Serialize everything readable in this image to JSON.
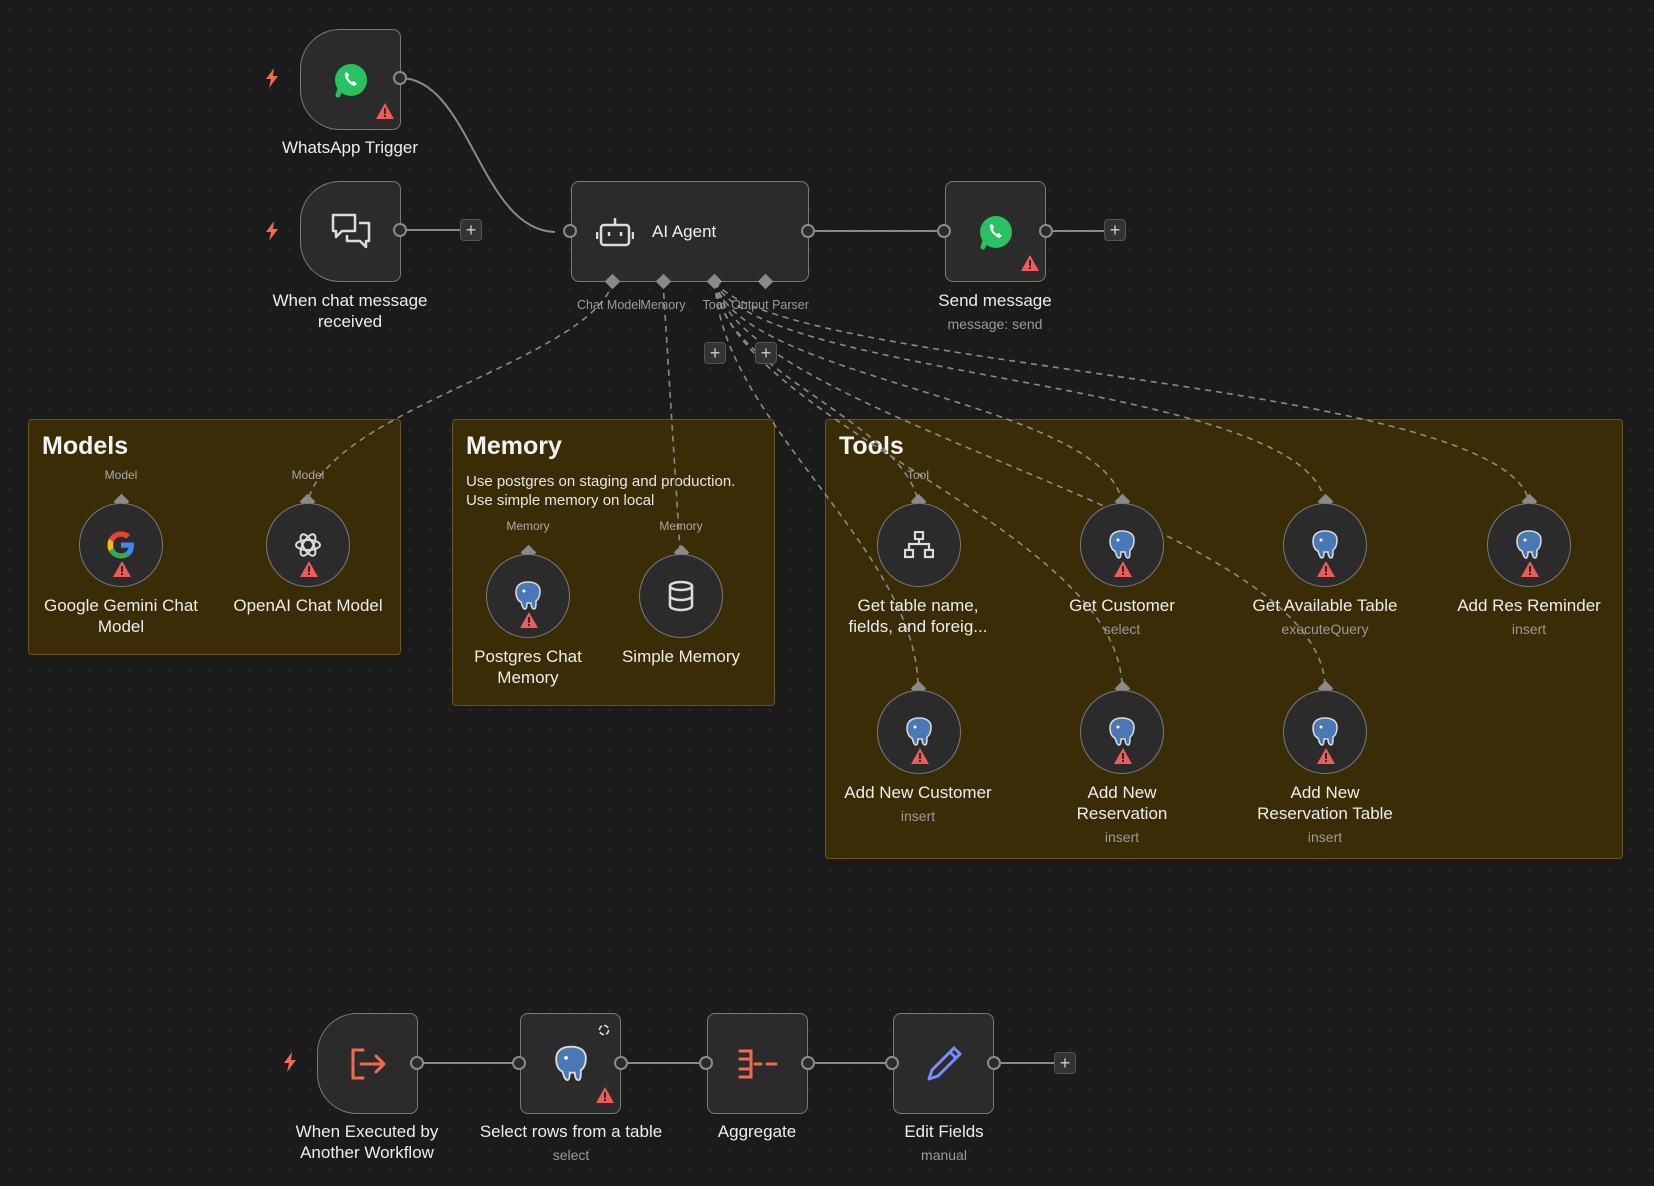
{
  "colors": {
    "background": "#1b1b1b",
    "node_fill": "#2b2b2b",
    "node_border": "#7a7a7a",
    "sticky_fill": "#3a2c07",
    "warning": "#ef5b5b",
    "trigger_bolt": "#ef6b52",
    "whatsapp_green": "#29c262",
    "postgres_blue": "#4a78b4",
    "edit_fields_blue": "#7b8cff"
  },
  "stickies": {
    "models": {
      "title": "Models"
    },
    "memory": {
      "title": "Memory",
      "text_line1": "Use postgres on staging and production.",
      "text_line2": "Use simple memory on local"
    },
    "tools": {
      "title": "Tools"
    }
  },
  "nodes": {
    "whatsapp_trigger": {
      "label": "WhatsApp Trigger",
      "icon": "whatsapp-icon"
    },
    "chat_trigger": {
      "label_line1": "When chat message",
      "label_line2": "received",
      "icon": "chat-bubbles-icon"
    },
    "ai_agent": {
      "label": "AI Agent",
      "icon": "robot-icon",
      "ports": [
        "Chat Model",
        "Memory",
        "Tool",
        "Output Parser"
      ]
    },
    "send_message": {
      "label": "Send message",
      "subtitle": "message: send",
      "icon": "whatsapp-icon"
    },
    "gemini": {
      "label_line1": "Google Gemini Chat",
      "label_line2": "Model",
      "port": "Model",
      "icon": "google-icon"
    },
    "openai": {
      "label": "OpenAI Chat Model",
      "port": "Model",
      "icon": "openai-icon"
    },
    "pg_memory": {
      "label_line1": "Postgres Chat",
      "label_line2": "Memory",
      "port": "Memory",
      "icon": "postgres-icon"
    },
    "simple_memory": {
      "label": "Simple Memory",
      "port": "Memory",
      "icon": "database-icon"
    },
    "get_table": {
      "label_line1": "Get table name,",
      "label_line2": "fields, and foreig...",
      "port": "Tool",
      "icon": "sitemap-icon"
    },
    "get_customer": {
      "label": "Get Customer",
      "subtitle": "select",
      "icon": "postgres-icon"
    },
    "get_available": {
      "label": "Get Available Table",
      "subtitle": "executeQuery",
      "icon": "postgres-icon"
    },
    "add_reminder": {
      "label": "Add Res Reminder",
      "subtitle": "insert",
      "icon": "postgres-icon"
    },
    "add_customer": {
      "label": "Add New Customer",
      "subtitle": "insert",
      "icon": "postgres-icon"
    },
    "add_reservation": {
      "label_line1": "Add New",
      "label_line2": "Reservation",
      "subtitle": "insert",
      "icon": "postgres-icon"
    },
    "add_res_table": {
      "label_line1": "Add New",
      "label_line2": "Reservation Table",
      "subtitle": "insert",
      "icon": "postgres-icon"
    },
    "exec_trigger": {
      "label_line1": "When Executed by",
      "label_line2": "Another Workflow",
      "icon": "sign-out-icon"
    },
    "select_rows": {
      "label": "Select rows from a table",
      "subtitle": "select",
      "icon": "postgres-icon"
    },
    "aggregate": {
      "label": "Aggregate",
      "icon": "aggregate-icon"
    },
    "edit_fields": {
      "label": "Edit Fields",
      "subtitle": "manual",
      "icon": "pencil-icon"
    }
  }
}
